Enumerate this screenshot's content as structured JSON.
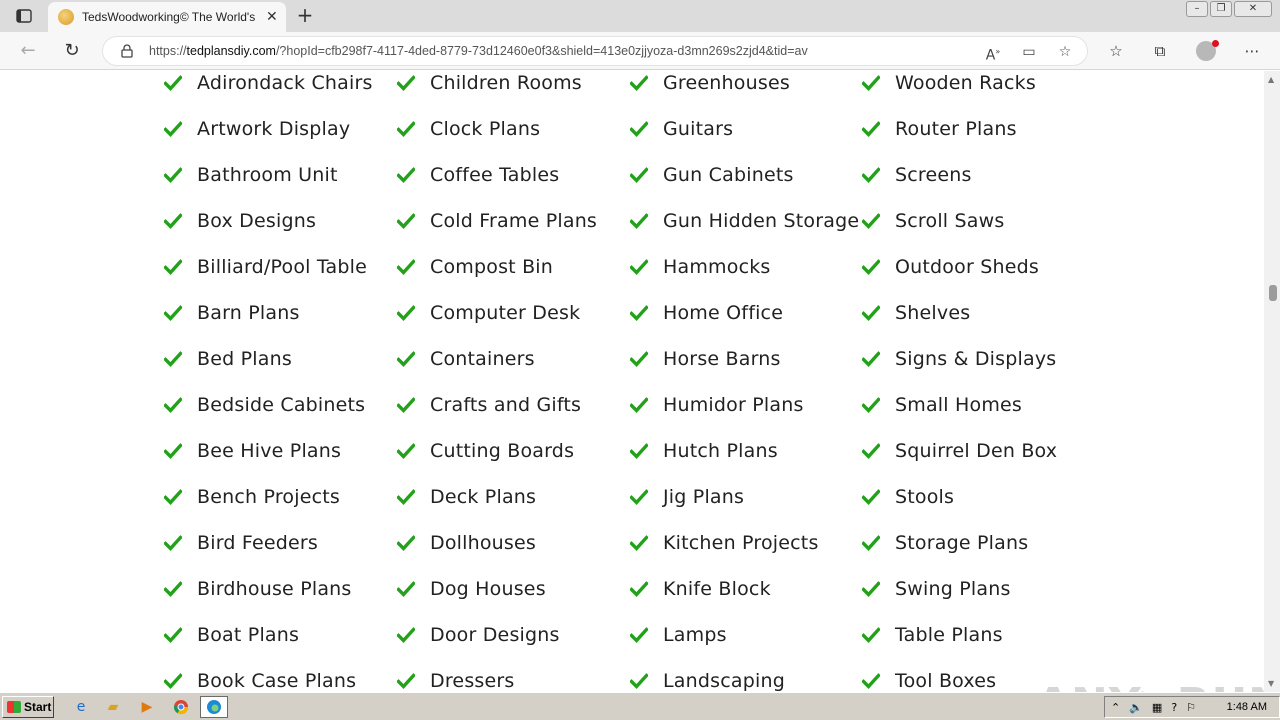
{
  "browser": {
    "tab_title": "TedsWoodworking© The World's",
    "url_domain": "tedplansdiy.com",
    "url_rest": "/?hopId=cfb298f7-4117-4ded-8779-73d12460e0f3&shield=413e0zjjyoza-d3mn269s2zjd4&tid=av",
    "url_prefix": "https://"
  },
  "columns": [
    [
      "Adirondack Chairs",
      "Artwork Display",
      "Bathroom Unit",
      "Box Designs",
      "Billiard/Pool Table",
      "Barn Plans",
      "Bed Plans",
      "Bedside Cabinets",
      "Bee Hive Plans",
      "Bench Projects",
      "Bird Feeders",
      "Birdhouse Plans",
      "Boat Plans",
      "Book Case Plans"
    ],
    [
      "Children Rooms",
      "Clock Plans",
      "Coffee Tables",
      "Cold Frame Plans",
      "Compost Bin",
      "Computer Desk",
      "Containers",
      "Crafts and Gifts",
      "Cutting Boards",
      "Deck Plans",
      "Dollhouses",
      "Dog Houses",
      "Door Designs",
      "Dressers"
    ],
    [
      "Greenhouses",
      "Guitars",
      "Gun Cabinets",
      "Gun Hidden Storage",
      "Hammocks",
      "Home Office",
      "Horse Barns",
      "Humidor Plans",
      "Hutch Plans",
      "Jig Plans",
      "Kitchen Projects",
      "Knife Block",
      "Lamps",
      "Landscaping"
    ],
    [
      "Wooden Racks",
      "Router Plans",
      "Screens",
      "Scroll Saws",
      "Outdoor Sheds",
      "Shelves",
      "Signs & Displays",
      "Small Homes",
      "Squirrel Den Box",
      "Stools",
      "Storage Plans",
      "Swing Plans",
      "Table Plans",
      "Tool Boxes"
    ]
  ],
  "check_color": "#23a11b",
  "watermark": "ANY▷RUN",
  "taskbar": {
    "start_label": "Start",
    "clock": "1:48 AM",
    "quick_icons": [
      "ie-icon",
      "explorer-icon",
      "media-player-icon",
      "chrome-icon",
      "edge-icon"
    ]
  }
}
